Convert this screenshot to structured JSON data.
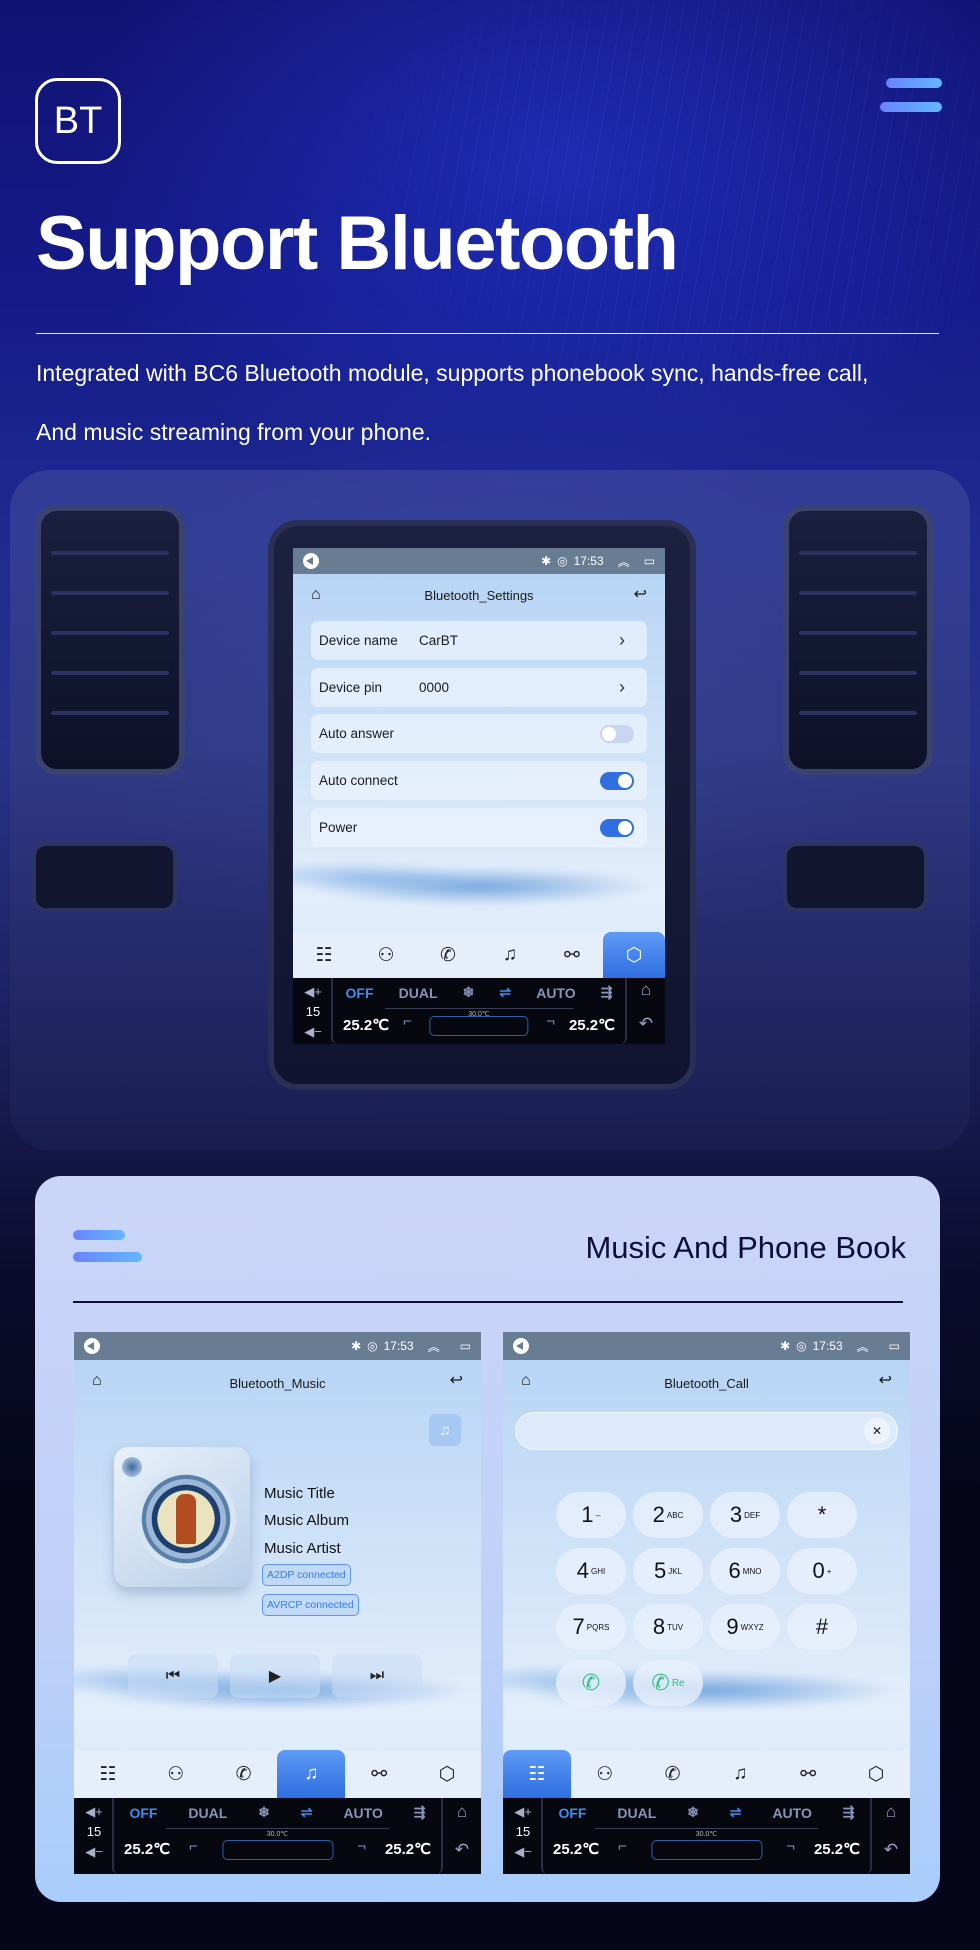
{
  "hero": {
    "badge": "BT",
    "title": "Support Bluetooth",
    "desc_line1": "Integrated with BC6 Bluetooth module, supports phonebook sync, hands-free call,",
    "desc_line2": "And music streaming from your phone."
  },
  "status": {
    "time": "17:53",
    "bt_glyph": "✱",
    "wifi_glyph": "◎",
    "up_glyph": "︽",
    "win_glyph": "▭"
  },
  "icons": {
    "home": "⌂",
    "return": "↩",
    "chevron": "›"
  },
  "settings_screen": {
    "title": "Bluetooth_Settings",
    "rows": [
      {
        "label": "Device name",
        "value": "CarBT",
        "type": "link"
      },
      {
        "label": "Device pin",
        "value": "0000",
        "type": "link"
      },
      {
        "label": "Auto answer",
        "type": "toggle",
        "on": false
      },
      {
        "label": "Auto connect",
        "type": "toggle",
        "on": true
      },
      {
        "label": "Power",
        "type": "toggle",
        "on": true
      }
    ],
    "active_tab": "settings"
  },
  "dock": {
    "items": [
      {
        "name": "apps",
        "glyph": "☷"
      },
      {
        "name": "contacts",
        "glyph": "⚇"
      },
      {
        "name": "phone",
        "glyph": "✆"
      },
      {
        "name": "music",
        "glyph": "♫"
      },
      {
        "name": "link",
        "glyph": "⚯"
      },
      {
        "name": "settings",
        "glyph": "⬡"
      }
    ]
  },
  "climate": {
    "vol_up": "◀+",
    "volume": "15",
    "vol_down": "◀−",
    "off": "OFF",
    "dual": "DUAL",
    "defrost": "❄",
    "recirc": "⇌",
    "auto": "AUTO",
    "airflow": "⇶",
    "set_temp": "30.0℃",
    "left_temp": "25.2℃",
    "right_temp": "25.2℃",
    "seat_left": "⌐",
    "seat_right": "¬",
    "home": "⌂",
    "back": "↶"
  },
  "card": {
    "title": "Music And Phone Book"
  },
  "music_screen": {
    "title": "Bluetooth_Music",
    "music_title": "Music Title",
    "music_album": "Music Album",
    "music_artist": "Music Artist",
    "a2dp": "A2DP  connected",
    "avrcp": "AVRCP connected",
    "prev": "⏮",
    "play": "▶",
    "next": "⏭",
    "note_btn": "♫",
    "active_tab": "music"
  },
  "call_screen": {
    "title": "Bluetooth_Call",
    "input_value": "",
    "clear": "✕",
    "keys": [
      {
        "d": "1",
        "s": "--"
      },
      {
        "d": "2",
        "s": "ABC"
      },
      {
        "d": "3",
        "s": "DEF"
      },
      {
        "d": "*",
        "s": ""
      },
      {
        "d": "4",
        "s": "GHI"
      },
      {
        "d": "5",
        "s": "JKL"
      },
      {
        "d": "6",
        "s": "MNO"
      },
      {
        "d": "0",
        "s": "+"
      },
      {
        "d": "7",
        "s": "PQRS"
      },
      {
        "d": "8",
        "s": "TUV"
      },
      {
        "d": "9",
        "s": "WXYZ"
      },
      {
        "d": "#",
        "s": ""
      }
    ],
    "call": "✆",
    "redial": "✆",
    "redial_label": "Re",
    "active_tab": "apps"
  }
}
